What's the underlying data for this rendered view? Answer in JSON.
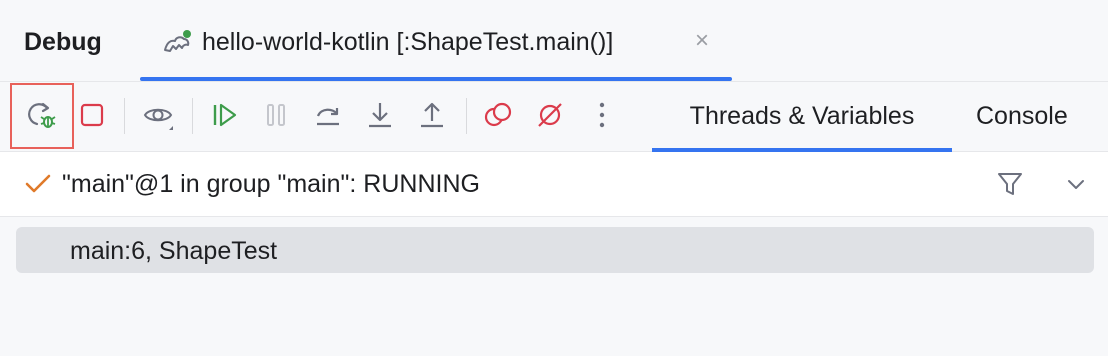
{
  "header": {
    "title": "Debug",
    "session_tab": {
      "label": "hello-world-kotlin [:ShapeTest.main()]",
      "icon": "kotlin-run-config-icon",
      "close_symbol": "×"
    }
  },
  "toolbar": {
    "buttons": [
      {
        "name": "rerun-debug",
        "icon": "rerun-bug-icon"
      },
      {
        "name": "stop",
        "icon": "stop-icon"
      },
      {
        "name": "view-options",
        "icon": "eye-icon"
      },
      {
        "name": "resume",
        "icon": "resume-icon"
      },
      {
        "name": "pause",
        "icon": "pause-icon"
      },
      {
        "name": "step-over",
        "icon": "step-over-icon"
      },
      {
        "name": "step-into",
        "icon": "step-into-icon"
      },
      {
        "name": "step-out",
        "icon": "step-out-icon"
      },
      {
        "name": "view-breakpoints",
        "icon": "breakpoints-icon"
      },
      {
        "name": "mute-breakpoints",
        "icon": "mute-breakpoints-icon"
      },
      {
        "name": "more",
        "icon": "more-vertical-icon"
      }
    ],
    "tabs": [
      {
        "label": "Threads & Variables",
        "selected": true
      },
      {
        "label": "Console",
        "selected": false
      }
    ]
  },
  "thread": {
    "label": "\"main\"@1 in group \"main\": RUNNING",
    "status_icon": "check-icon"
  },
  "frames": [
    {
      "label": "main:6, ShapeTest",
      "selected": true
    }
  ],
  "colors": {
    "accent": "#3574f0",
    "highlight": "#e8615a",
    "resume_green": "#3e9c4b",
    "stop_red": "#db3b4b",
    "check_orange": "#e07a2a"
  }
}
